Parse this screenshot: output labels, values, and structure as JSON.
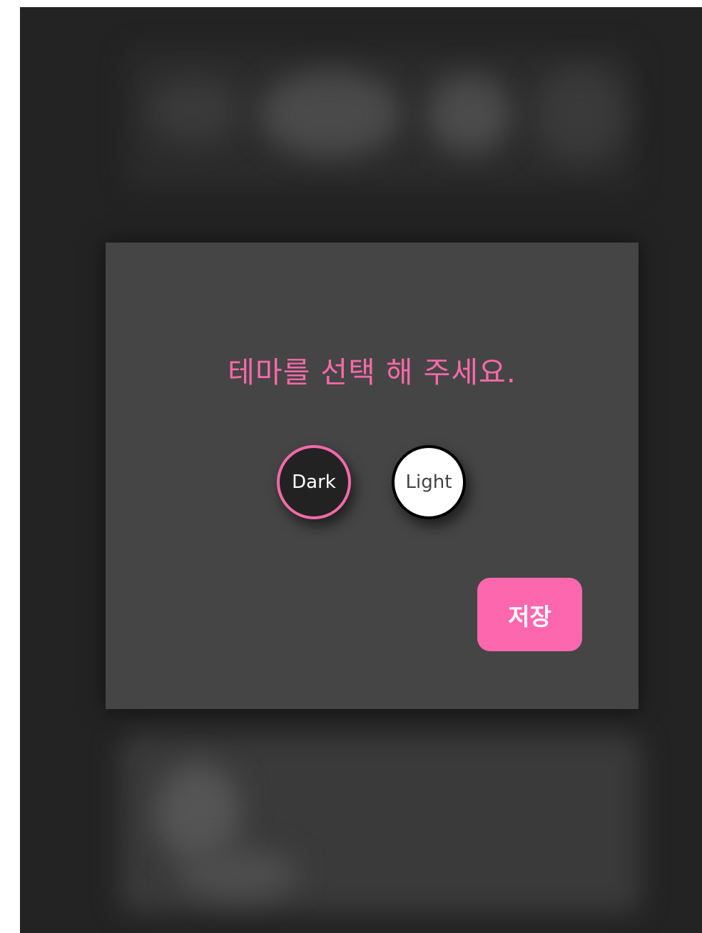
{
  "modal": {
    "title": "테마를 선택 해 주세요.",
    "options": [
      {
        "label": "Dark",
        "selected": true
      },
      {
        "label": "Light",
        "selected": false
      }
    ],
    "save_label": "저장"
  },
  "colors": {
    "accent": "#f56aa8",
    "save_button": "#fc67ae",
    "modal_bg": "#454545",
    "screen_bg": "#232323"
  }
}
